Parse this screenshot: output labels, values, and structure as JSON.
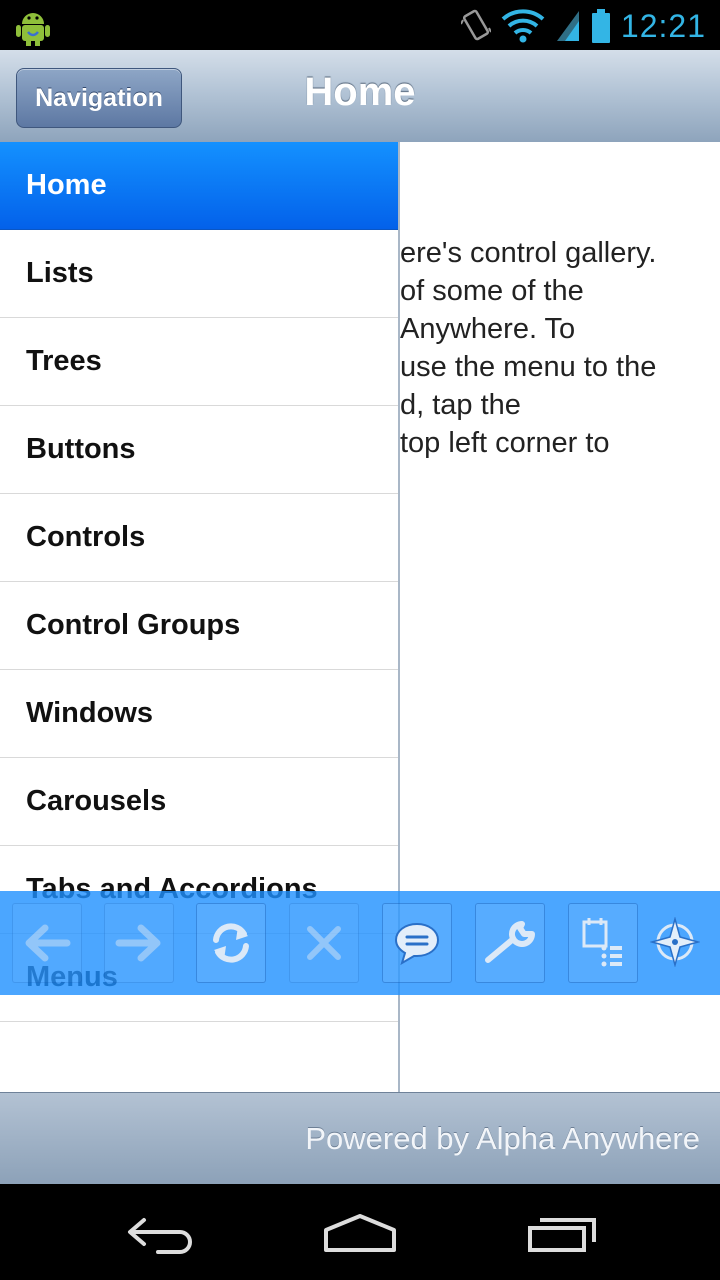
{
  "status_bar": {
    "time": "12:21",
    "icons": [
      "android-debug-icon",
      "vibrate-icon",
      "wifi-icon",
      "signal-icon",
      "battery-icon"
    ],
    "time_color": "#33b5e5"
  },
  "header": {
    "nav_button_label": "Navigation",
    "title": "Home"
  },
  "drawer": {
    "items": [
      {
        "label": "Home",
        "active": true
      },
      {
        "label": "Lists",
        "active": false
      },
      {
        "label": "Trees",
        "active": false
      },
      {
        "label": "Buttons",
        "active": false
      },
      {
        "label": "Controls",
        "active": false
      },
      {
        "label": "Control Groups",
        "active": false
      },
      {
        "label": "Windows",
        "active": false
      },
      {
        "label": "Carousels",
        "active": false
      },
      {
        "label": "Tabs and Accordions",
        "active": false
      },
      {
        "label": "Menus",
        "active": false
      }
    ],
    "active_color": "#0a6cf5"
  },
  "content": {
    "lines": [
      "ere's control gallery.",
      "  of some of the",
      "  Anywhere. To",
      "use the menu to the",
      "d, tap the",
      "top left corner to"
    ]
  },
  "toolbar": {
    "buttons": [
      {
        "icon": "back-arrow-icon",
        "enabled": false
      },
      {
        "icon": "forward-arrow-icon",
        "enabled": false
      },
      {
        "icon": "refresh-icon",
        "enabled": true
      },
      {
        "icon": "stop-icon",
        "enabled": false
      },
      {
        "icon": "chat-bubble-icon",
        "enabled": true
      },
      {
        "icon": "wrench-icon",
        "enabled": true
      },
      {
        "icon": "calendar-list-icon",
        "enabled": true
      },
      {
        "icon": "compass-icon",
        "enabled": true
      }
    ],
    "color": "#1e90ff"
  },
  "footer": {
    "text": "Powered by Alpha Anywhere"
  },
  "system_nav": {
    "icons": [
      "back-icon",
      "home-icon",
      "recent-apps-icon"
    ]
  }
}
